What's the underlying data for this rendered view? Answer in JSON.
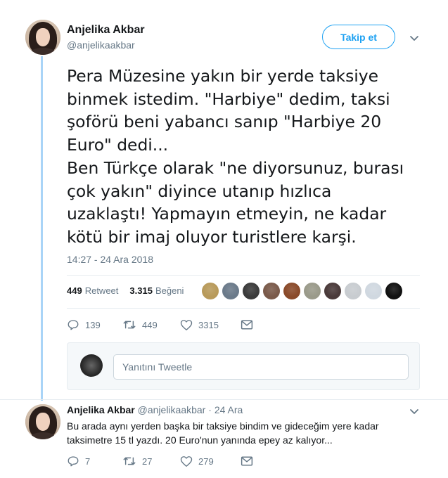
{
  "main_tweet": {
    "author_name": "Anjelika Akbar",
    "author_handle": "@anjelikaakbar",
    "follow_label": "Takip et",
    "text_lines": [
      "Pera Müzesine yakın bir yerde taksiye",
      "binmek istedim. \"Harbiye\" dedim, taksi",
      "şoförü beni yabancı sanıp \"Harbiye 20",
      "Euro\" dedi...",
      "Ben Türkçe olarak \"ne diyorsunuz, burası",
      "çok yakın\" diyince utanıp hızlıca",
      "uzaklaştı! Yapmayın etmeyin, ne kadar",
      "kötü bir imaj oluyor turistlere karşi."
    ],
    "timestamp": "14:27 - 24 Ara 2018",
    "retweet_count": "449",
    "retweet_label": "Retweet",
    "like_count": "3.315",
    "like_label": "Beğeni",
    "liker_avatar_colors": [
      "#b89a5a",
      "#6b7a8a",
      "#3b3b3b",
      "#7a5a4a",
      "#8a4a2a",
      "#9a9a8a",
      "#4a3a3a",
      "#c8ccd0",
      "#d0d8e0",
      "#111111"
    ],
    "actions": {
      "reply_count": "139",
      "retweet_count": "449",
      "like_count": "3315"
    }
  },
  "reply_box": {
    "placeholder": "Yanıtını Tweetle"
  },
  "reply_tweet": {
    "author_name": "Anjelika Akbar",
    "author_handle": "@anjelikaakbar",
    "separator": "·",
    "date": "24 Ara",
    "text_lines": [
      "Bu arada aynı yerden başka bir taksiye bindim ve gideceğim yere kadar",
      "taksimetre 15 tl yazdı. 20 Euro'nun yanında epey az kalıyor..."
    ],
    "actions": {
      "reply_count": "7",
      "retweet_count": "27",
      "like_count": "279"
    }
  },
  "colors": {
    "accent": "#1da1f2",
    "thread_line": "#a9d4f7",
    "secondary_text": "#657786"
  }
}
